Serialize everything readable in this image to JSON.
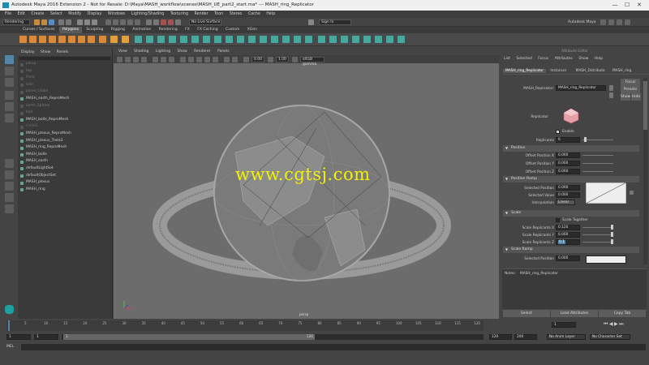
{
  "title": "Autodesk Maya 2016 Extension 2 - Not for Resale: D:\\Maya\\MASH_workflow\\scenes\\MASH_UE_part2_start.ma* --- MASH_ring_Replicator",
  "window_controls": [
    "—",
    "☐",
    "✕"
  ],
  "menus": [
    "File",
    "Edit",
    "Create",
    "Select",
    "Modify",
    "Display",
    "Windows",
    "Lighting/Shading",
    "Texturing",
    "Render",
    "Toon",
    "Stereo",
    "Cache",
    "Help"
  ],
  "status_line": {
    "mode": "Rendering",
    "surface": "No Live Surface",
    "sign_in": "Sign In",
    "account": "Autodesk Maya"
  },
  "shelf_tabs": [
    "Curves / Surfaces",
    "Polygons",
    "Sculpting",
    "Rigging",
    "Animation",
    "Rendering",
    "FX",
    "FX Caching",
    "Custom",
    "XGen"
  ],
  "active_shelf": "Polygons",
  "outliner": {
    "menu": [
      "Display",
      "Show",
      "Panels"
    ],
    "items": [
      {
        "label": "persp",
        "dim": true
      },
      {
        "label": "top",
        "dim": true
      },
      {
        "label": "front",
        "dim": true
      },
      {
        "label": "side",
        "dim": true
      },
      {
        "label": "plane_Globe",
        "dim": true
      },
      {
        "label": "MASH_earth_ReproMesh",
        "dim": false
      },
      {
        "label": "earth_Sphere",
        "dim": true
      },
      {
        "label": "bolt",
        "dim": true
      },
      {
        "label": "MASH_bolts_ReproMesh",
        "dim": false
      },
      {
        "label": "circle1",
        "dim": true
      },
      {
        "label": "MASH_plexus_ReproMesh",
        "dim": false
      },
      {
        "label": "MASH_plexus_Trails2",
        "dim": false
      },
      {
        "label": "MASH_ring_ReproMesh",
        "dim": false
      },
      {
        "label": "MASH_bolts",
        "dim": false
      },
      {
        "label": "MASH_earth",
        "dim": false
      },
      {
        "label": "defaultLightSet",
        "dim": false
      },
      {
        "label": "defaultObjectSet",
        "dim": false
      },
      {
        "label": "MASH_plexus",
        "dim": false
      },
      {
        "label": "MASH_ring",
        "dim": false
      }
    ]
  },
  "viewport": {
    "menu": [
      "View",
      "Shading",
      "Lighting",
      "Show",
      "Renderer",
      "Panels"
    ],
    "gamma": "sRGB gamma",
    "value1": "0.00",
    "value2": "1.00",
    "camera": "persp"
  },
  "watermark": "www.cgtsj.com",
  "attribute_editor": {
    "title": "Attribute Editor",
    "menu": [
      "List",
      "Selected",
      "Focus",
      "Attributes",
      "Show",
      "Help"
    ],
    "tabs": [
      "MASH_ring_Replicator",
      "Instancer",
      "MASH_Distribute",
      "MASH_ring"
    ],
    "node_label": "MASH_Replicator:",
    "node_name": "MASH_ring_Replicator",
    "buttons": {
      "focus": "Focus",
      "presets": "Presets",
      "show": "Show",
      "hide": "Hide"
    },
    "replicator_label": "Replicator",
    "enable": "Enable",
    "replicants_label": "Replicants",
    "replicants": "6",
    "sections": {
      "position": "Position",
      "position_ramp": "Position Ramp",
      "scale": "Scale",
      "scale_ramp": "Scale Ramp"
    },
    "offset_x_label": "Offset Position X",
    "offset_x": "0.000",
    "offset_y_label": "Offset Position Y",
    "offset_y": "0.000",
    "offset_z_label": "Offset Position Z",
    "offset_z": "0.000",
    "sel_pos_label": "Selected Position",
    "sel_pos": "0.000",
    "sel_val_label": "Selected Value",
    "sel_val": "0.000",
    "interp_label": "Interpolation",
    "interp": "Linear",
    "scale_together": "Scale Together",
    "scale_x_label": "Scale Replicants X",
    "scale_x": "0.120",
    "scale_y_label": "Scale Replicants Y",
    "scale_y": "0.000",
    "scale_z_label": "Scale Replicants Z",
    "scale_z": "0.1",
    "sel_pos2_label": "Selected Position",
    "sel_pos2": "0.000",
    "notes_label": "Notes:",
    "notes_node": "MASH_ring_Replicator",
    "footer": [
      "Select",
      "Load Attributes",
      "Copy Tab"
    ]
  },
  "timeline": {
    "ticks": [
      "5",
      "10",
      "15",
      "20",
      "25",
      "30",
      "35",
      "40",
      "45",
      "50",
      "55",
      "60",
      "65",
      "70",
      "75",
      "80",
      "85",
      "90",
      "95",
      "100",
      "105",
      "110",
      "115",
      "120"
    ],
    "current": "1"
  },
  "range": {
    "start": "1",
    "inner_start": "1",
    "inner_start2": "1",
    "inner_end": "120",
    "end": "120",
    "end2": "200",
    "anim_layer": "No Anim Layer",
    "char_set": "No Character Set"
  },
  "command": {
    "label": "MEL"
  },
  "colors": {
    "accent": "#5285a6",
    "watermark": "#f2f200"
  }
}
